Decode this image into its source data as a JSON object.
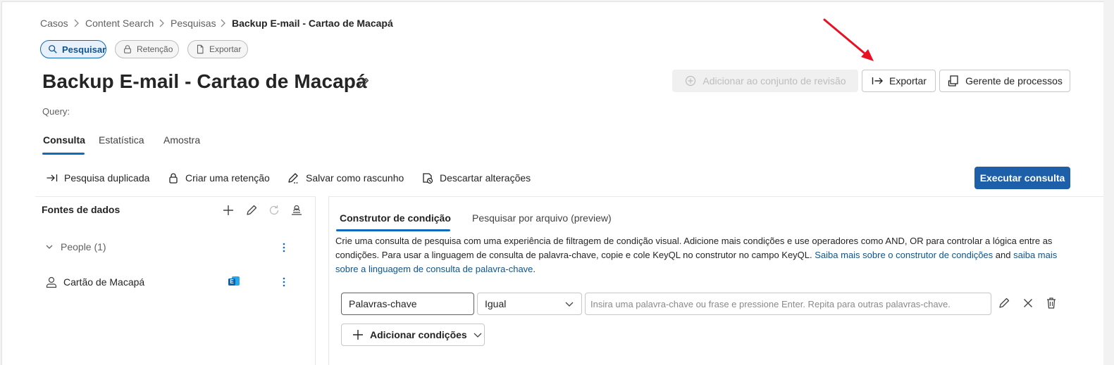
{
  "breadcrumb": {
    "items": [
      "Casos",
      "Content Search",
      "Pesquisas"
    ],
    "current": "Backup E-mail - Cartao de Macapá"
  },
  "pills": {
    "search": "Pesquisar",
    "hold": "Retenção",
    "export": "Exportar"
  },
  "page": {
    "title": "Backup E-mail - Cartao de Macapá",
    "query_label": "Query:"
  },
  "actions": {
    "add_review_set": "Adicionar ao conjunto de revisão",
    "export": "Exportar",
    "process_manager": "Gerente de processos"
  },
  "tabs": [
    "Consulta",
    "Estatística",
    "Amostra"
  ],
  "toolbar": {
    "duplicate": "Pesquisa duplicada",
    "create_hold": "Criar uma retenção",
    "save_draft": "Salvar como rascunho",
    "discard": "Descartar alterações",
    "run": "Executar consulta"
  },
  "data_sources": {
    "title": "Fontes de dados",
    "group_label": "People (1)",
    "source_name": "Cartão de Macapá",
    "source_badge": "E"
  },
  "builder": {
    "tabs": [
      "Construtor de condição",
      "Pesquisar por arquivo (preview)"
    ],
    "description_1": "Crie uma consulta de pesquisa com uma experiência de filtragem de condição visual. Adicione mais condições e use operadores como AND, OR para controlar a lógica entre as condições. Para usar a linguagem de consulta de palavra-chave, copie e cole KeyQL no construtor no campo KeyQL. ",
    "link_1": "Saiba mais sobre o construtor de condições",
    "description_2": " and ",
    "link_2": "saiba mais sobre a linguagem de consulta de palavra-chave",
    "description_3": ".",
    "condition": {
      "field": "Palavras-chave",
      "operator": "Igual",
      "value_placeholder": "Insira uma palavra-chave ou frase e pressione Enter. Repita para outras palavras-chave."
    },
    "add_conditions": "Adicionar condições"
  },
  "colors": {
    "accent": "#0f6cbd",
    "primary_button": "#1d5fa8",
    "annotation_arrow": "#e81123"
  }
}
